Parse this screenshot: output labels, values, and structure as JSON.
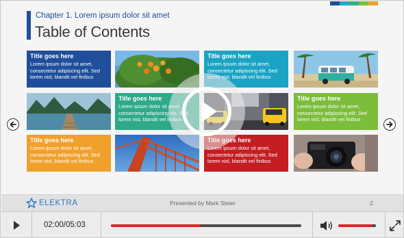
{
  "slide": {
    "chapter": "Chapter 1. Lorem ipsum dolor sit amet",
    "title": "Table of Contents",
    "palette": [
      "#1f4e9a",
      "#2aa7c6",
      "#35b08a",
      "#7bbf3a",
      "#e8a42a"
    ]
  },
  "tiles": [
    {
      "title": "Title goes here",
      "body": "Lorem ipsum dolor sit amet, consectetur adipiscing elit. Sed lorem nisl, blandit vel finibus",
      "color": "#1f4e9a"
    },
    {
      "title": "Title goes here",
      "body": "Lorem ipsum dolor sit amet, consectetur adipiscing elit. Sed lorem nisl, blandit vel finibus",
      "color": "#1ba3c4"
    },
    {
      "title": "Title goes here",
      "body": "Lorem ipsum dolor sit amet, consectetur adipiscing elit. Sed lorem nisl, blandit vel finibus",
      "color": "#2ea98a"
    },
    {
      "title": "Title goes here",
      "body": "Lorem ipsum dolor sit amet, consectetur adipiscing elit. Sed lorem nisl, blandit vel finibus",
      "color": "#7cbd3c"
    },
    {
      "title": "Title goes here",
      "body": "Lorem ipsum dolor sit amet, consectetur adipiscing elit. Sed lorem nisl, blandit vel finibus",
      "color": "#f0a12c"
    },
    {
      "title": "Title goes here",
      "body": "Lorem ipsum dolor sit amet, consectetur adipiscing elit. Sed lorem nisl, blandit vel finibus",
      "color": "#c41d22"
    }
  ],
  "photos": [
    "orange-tree-photo",
    "camper-van-beach-photo",
    "lake-pier-photo",
    "city-taxis-photo",
    "bridge-cables-photo",
    "camera-hands-photo"
  ],
  "footer": {
    "brand": "ELEKTRA",
    "presenter": "Presented by Mark Steier",
    "page": "2"
  },
  "player": {
    "time": "02:00/05:03",
    "progress": 0.47,
    "volume": 0.9,
    "accent": "#e0202a"
  }
}
